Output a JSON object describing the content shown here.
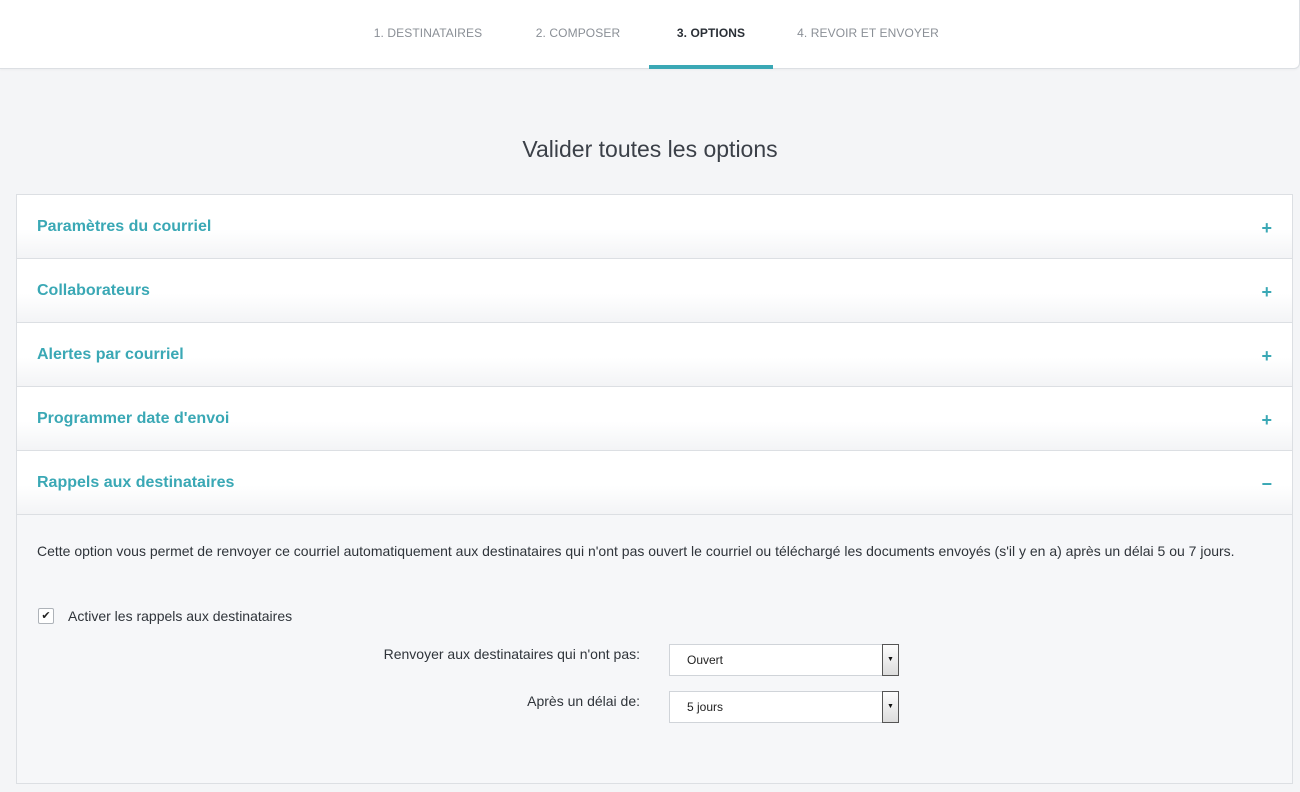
{
  "steps": [
    {
      "label": "1. DESTINATAIRES"
    },
    {
      "label": "2. COMPOSER"
    },
    {
      "label": "3. OPTIONS"
    },
    {
      "label": "4. REVOIR ET ENVOYER"
    }
  ],
  "page_title": "Valider toutes les options",
  "sections": [
    {
      "title": "Paramètres du courriel",
      "toggle": "+"
    },
    {
      "title": "Collaborateurs",
      "toggle": "+"
    },
    {
      "title": "Alertes par courriel",
      "toggle": "+"
    },
    {
      "title": "Programmer date d'envoi",
      "toggle": "+"
    },
    {
      "title": "Rappels aux destinataires",
      "toggle": "−"
    }
  ],
  "reminders": {
    "description": "Cette option vous permet de renvoyer ce courriel automatiquement aux destinataires qui n'ont pas ouvert le courriel ou téléchargé les documents envoyés (s'il y en a) après un délai 5 ou 7 jours.",
    "checkbox_label": "Activer les rappels aux destinataires",
    "checkbox_checked": true,
    "checkbox_mark": "✔",
    "resend_label": "Renvoyer aux destinataires qui n'ont pas:",
    "resend_value": "Ouvert",
    "delay_label": "Après un délai de:",
    "delay_value": "5 jours",
    "arrow_glyph": "▼"
  },
  "colors": {
    "accent": "#3aa8b5",
    "background": "#f4f5f7"
  }
}
